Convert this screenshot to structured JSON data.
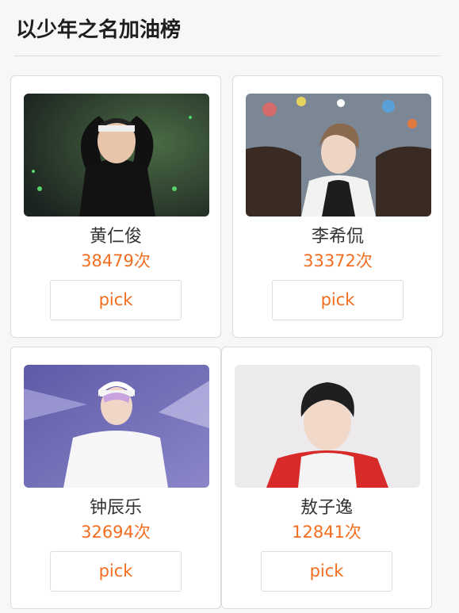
{
  "header": {
    "title": "以少年之名加油榜"
  },
  "theme": {
    "accent": "#f26d1f",
    "text": "#333333",
    "border": "#dddddd",
    "background": "#f7f7f7"
  },
  "cards": [
    {
      "name": "黄仁俊",
      "count": "38479次",
      "button": "pick",
      "photo": "performer-heart-pose-stage-photo"
    },
    {
      "name": "李希侃",
      "count": "33372次",
      "button": "pick",
      "photo": "performer-sofa-portrait-photo"
    },
    {
      "name": "钟辰乐",
      "count": "32694次",
      "button": "pick",
      "photo": "performer-white-outfit-stage-photo"
    },
    {
      "name": "敖子逸",
      "count": "12841次",
      "button": "pick",
      "photo": "performer-red-hoodie-portrait-photo"
    }
  ]
}
